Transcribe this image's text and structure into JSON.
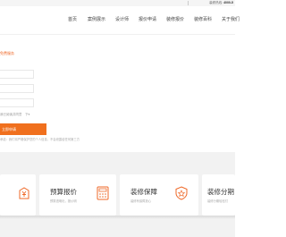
{
  "topbar": {
    "hotline_label": "装修热线:",
    "hotline_number": "4000-5"
  },
  "nav": {
    "items": [
      "首页",
      "案例展示",
      "设计师",
      "报价申请",
      "装修报价",
      "装修百科",
      "关于我们"
    ]
  },
  "form": {
    "title": "免费服务",
    "agree_text": "我已阅读并同意",
    "agree_dropdown": "下▾",
    "submit_label": "立即申请",
    "privacy_text": "承诺：我们将严格保护您的个人信息，不会泄露给任何第三方"
  },
  "services": [
    {
      "title": "",
      "desc": "",
      "icon": "yuan-icon"
    },
    {
      "title": "预算报价",
      "desc": "预算透明化，报价明",
      "icon": "calculator-icon"
    },
    {
      "title": "装修保障",
      "desc": "装修有保障放心",
      "icon": "shield-star-icon"
    },
    {
      "title": "装修分期",
      "desc": "装修分期轻松付",
      "icon": "installment-icon"
    }
  ]
}
